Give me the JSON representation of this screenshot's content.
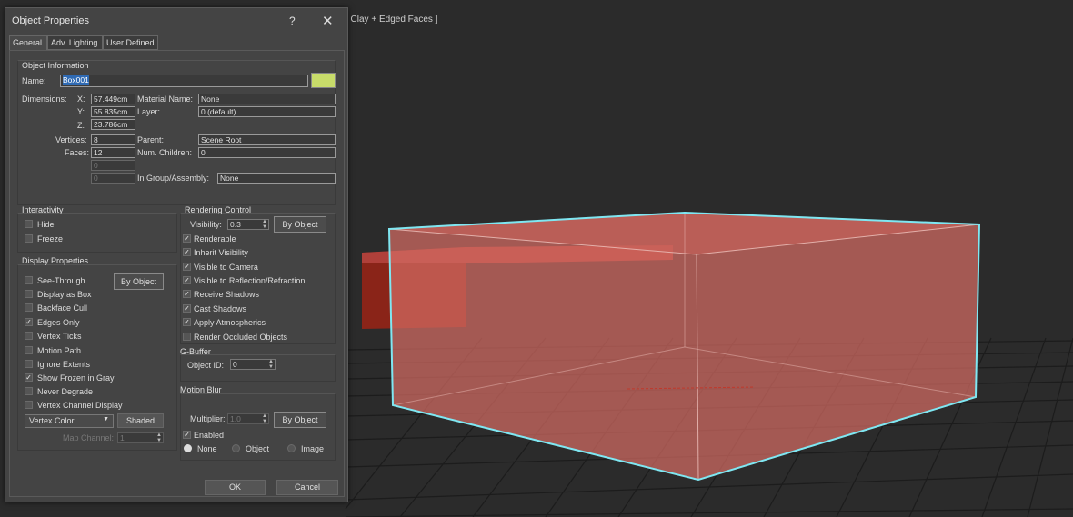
{
  "viewport": {
    "label": "[ Clay + Edged Faces ]"
  },
  "dialog": {
    "title": "Object Properties",
    "help_label": "?",
    "close_label": "✕",
    "tabs": [
      "General",
      "Adv. Lighting",
      "User Defined"
    ],
    "object_info": {
      "heading": "Object Information",
      "name_label": "Name:",
      "name_value": "Box001",
      "swatch_color": "#c8dc6a",
      "dimensions_label": "Dimensions:",
      "x_label": "X:",
      "x_value": "57.449cm",
      "y_label": "Y:",
      "y_value": "55.835cm",
      "z_label": "Z:",
      "z_value": "23.786cm",
      "vertices_label": "Vertices:",
      "vertices_value": "8",
      "faces_label": "Faces:",
      "faces_value": "12",
      "extra1_value": "0",
      "extra2_value": "0",
      "material_label": "Material Name:",
      "material_value": "None",
      "layer_label": "Layer:",
      "layer_value": "0 (default)",
      "parent_label": "Parent:",
      "parent_value": "Scene Root",
      "children_label": "Num. Children:",
      "children_value": "0",
      "group_label": "In Group/Assembly:",
      "group_value": "None"
    },
    "interactivity": {
      "heading": "Interactivity",
      "hide": "Hide",
      "freeze": "Freeze"
    },
    "display": {
      "heading": "Display Properties",
      "by_object": "By Object",
      "items": [
        "See-Through",
        "Display as Box",
        "Backface Cull",
        "Edges Only",
        "Vertex Ticks",
        "Motion Path",
        "Ignore Extents",
        "Show Frozen in Gray",
        "Never Degrade",
        "Vertex Channel Display"
      ],
      "vertex_color": "Vertex Color",
      "shaded": "Shaded",
      "map_channel_label": "Map Channel:",
      "map_channel_value": "1"
    },
    "rendering": {
      "heading": "Rendering Control",
      "visibility_label": "Visibility:",
      "visibility_value": "0.3",
      "by_object": "By Object",
      "items": [
        "Renderable",
        "Inherit Visibility",
        "Visible to Camera",
        "Visible to Reflection/Refraction",
        "Receive Shadows",
        "Cast Shadows",
        "Apply Atmospherics",
        "Render Occluded Objects"
      ]
    },
    "gbuffer": {
      "heading": "G-Buffer",
      "object_id_label": "Object ID:",
      "object_id_value": "0"
    },
    "motion_blur": {
      "heading": "Motion Blur",
      "multiplier_label": "Multiplier:",
      "multiplier_value": "1.0",
      "by_object": "By Object",
      "enabled": "Enabled",
      "none": "None",
      "object": "Object",
      "image": "Image"
    },
    "ok": "OK",
    "cancel": "Cancel"
  }
}
